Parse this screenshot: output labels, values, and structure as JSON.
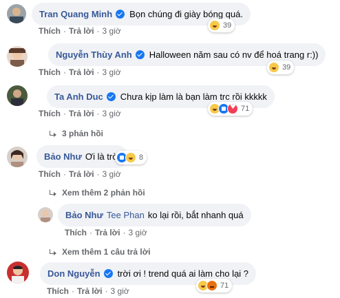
{
  "actions": {
    "like": "Thích",
    "reply": "Trả lời",
    "sep": "·"
  },
  "comments": [
    {
      "name": "Tran Quang Minh",
      "text": "Bọn chúng đi giày bóng quá.",
      "time": "3 giờ",
      "count": "39"
    },
    {
      "name": "Nguyễn Thùy Anh",
      "text": "Halloween năm sau có nv để hoá trang r:))",
      "time": "3 giờ",
      "count": "39"
    },
    {
      "name": "Ta Anh Duc",
      "text": "Chưa kịp làm là bạn làm trc rồi kkkkk",
      "time": "3 giờ",
      "count": "71",
      "replies": "3 phản hồi"
    },
    {
      "name": "Bảo Như",
      "text": "Ơi là trời",
      "time": "3 giờ",
      "count": "8",
      "replies": "Xem thêm 2 phản hồi"
    },
    {
      "name": "Bảo Như",
      "tag": "Tee Phan",
      "text": "ko lại rồi, bắt nhanh quá",
      "time": "3 giờ",
      "replies": "Xem thêm 1 câu trả lời"
    },
    {
      "name": "Don Nguyễn",
      "text": "trời ơi ! trend quá ai làm cho lại ?",
      "time": "3 giờ",
      "count": "71"
    }
  ],
  "colors": {
    "name": "#385898",
    "bubble": "#f0f2f5",
    "verified": "#1877f2",
    "meta": "#65676b"
  }
}
